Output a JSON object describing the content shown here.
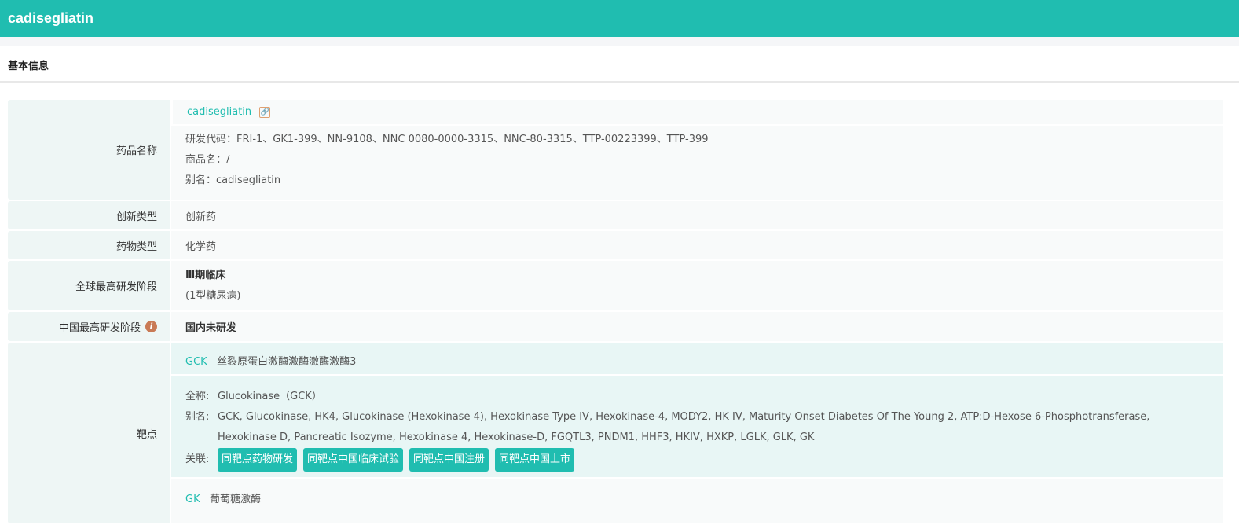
{
  "header": {
    "title": "cadisegliatin"
  },
  "section": {
    "title": "基本信息"
  },
  "rows": {
    "name": {
      "label": "药品名称",
      "main": "cadisegliatin",
      "code": "研发代码：FRI-1、GK1-399、NN-9108、NNC 0080-0000-3315、NNC-80-3315、TTP-00223399、TTP-399",
      "trade": "商品名：/",
      "alias": "别名：cadisegliatin"
    },
    "innovation": {
      "label": "创新类型",
      "value": "创新药"
    },
    "drugtype": {
      "label": "药物类型",
      "value": "化学药"
    },
    "global": {
      "label": "全球最高研发阶段",
      "value": "Ⅲ期临床",
      "note": "(1型糖尿病)"
    },
    "china": {
      "label": "中国最高研发阶段",
      "value": "国内未研发"
    },
    "target": {
      "label": "靶点",
      "items": [
        {
          "code": "GCK",
          "name": "丝裂原蛋白激酶激酶激酶激酶3",
          "full_label": "全称:",
          "full": "Glucokinase（GCK）",
          "alias_label": "别名:",
          "alias": "GCK, Glucokinase, HK4, Glucokinase (Hexokinase 4), Hexokinase Type IV, Hexokinase-4, MODY2, HK IV, Maturity Onset Diabetes Of The Young 2, ATP:D-Hexose 6-Phosphotransferase, Hexokinase D, Pancreatic Isozyme, Hexokinase 4, Hexokinase-D, FGQTL3, PNDM1, HHF3, HKIV, HXKP, LGLK, GLK, GK",
          "rel_label": "关联:",
          "tags": [
            "同靶点药物研发",
            "同靶点中国临床试验",
            "同靶点中国注册",
            "同靶点中国上市"
          ]
        },
        {
          "code": "GK",
          "name": "葡萄糖激酶"
        }
      ]
    }
  }
}
